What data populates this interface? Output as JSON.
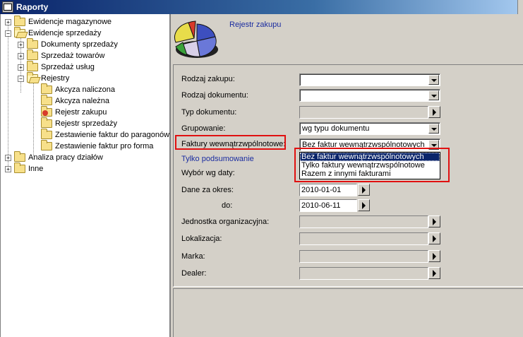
{
  "window": {
    "title": "Raporty"
  },
  "tree": {
    "items": [
      {
        "label": "Ewidencje magazynowe",
        "expander": "+"
      },
      {
        "label": "Ewidencje sprzedaży",
        "expander": "−"
      },
      {
        "label": "Dokumenty sprzedaży",
        "expander": "+"
      },
      {
        "label": "Sprzedaż towarów",
        "expander": "+"
      },
      {
        "label": "Sprzedaż usług",
        "expander": "+"
      },
      {
        "label": "Rejestry",
        "expander": "−"
      },
      {
        "label": "Akcyza naliczona"
      },
      {
        "label": "Akcyza należna"
      },
      {
        "label": "Rejestr zakupu"
      },
      {
        "label": "Rejestr sprzedaży"
      },
      {
        "label": "Zestawienie faktur do paragonów"
      },
      {
        "label": "Zestawienie faktur pro forma"
      },
      {
        "label": "Analiza pracy działów",
        "expander": "+"
      },
      {
        "label": "Inne",
        "expander": "+"
      }
    ]
  },
  "report": {
    "title": "Rejestr zakupu"
  },
  "form": {
    "rodzaj_zakupu": {
      "label": "Rodzaj zakupu:",
      "value": ""
    },
    "rodzaj_dokumentu": {
      "label": "Rodzaj dokumentu:",
      "value": ""
    },
    "typ_dokumentu": {
      "label": "Typ dokumentu:"
    },
    "grupowanie": {
      "label": "Grupowanie:",
      "value": "wg typu dokumentu"
    },
    "faktury": {
      "label": "Faktury wewnątrzwpólnotowe:",
      "value": "Bez faktur wewnątrzwspólnotowych"
    },
    "tylko_podsumowanie": {
      "label": "Tylko podsumowanie"
    },
    "wybor_daty": {
      "label": "Wybór wg daty:"
    },
    "dane_za_okres": {
      "label": "Dane za okres:",
      "value": "2010-01-01"
    },
    "do": {
      "label": "do:",
      "value": "2010-06-11"
    },
    "jednostka": {
      "label": "Jednostka organizacyjna:"
    },
    "lokalizacja": {
      "label": "Lokalizacja:"
    },
    "marka": {
      "label": "Marka:"
    },
    "dealer": {
      "label": "Dealer:"
    }
  },
  "dropdown": {
    "options": [
      "Bez faktur wewnątrzwspólnotowych",
      "Tylko faktury wewnątrzwspólnotowe",
      "Razem z innymi fakturami"
    ],
    "selected_index": 0
  },
  "colors": {
    "highlight_box": "#e01010",
    "selection": "#0a246a",
    "link": "#1a2ca0"
  }
}
